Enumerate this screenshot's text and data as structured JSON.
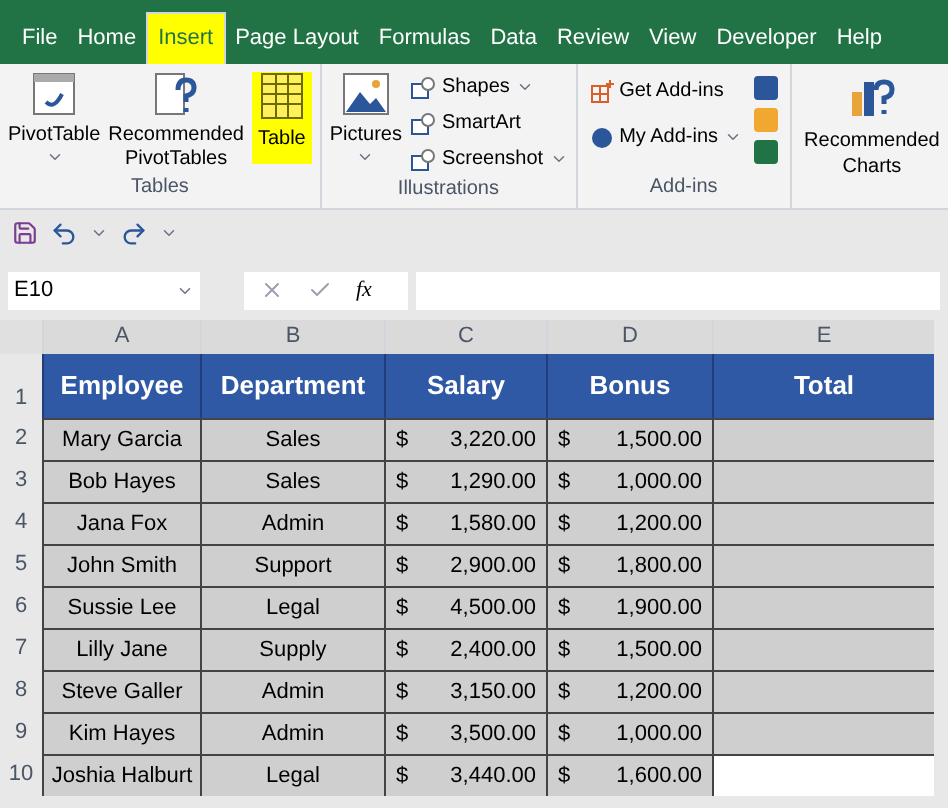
{
  "tabs": [
    {
      "label": "File",
      "selected": false
    },
    {
      "label": "Home",
      "selected": false
    },
    {
      "label": "Insert",
      "selected": true
    },
    {
      "label": "Page Layout",
      "selected": false
    },
    {
      "label": "Formulas",
      "selected": false
    },
    {
      "label": "Data",
      "selected": false
    },
    {
      "label": "Review",
      "selected": false
    },
    {
      "label": "View",
      "selected": false
    },
    {
      "label": "Developer",
      "selected": false
    },
    {
      "label": "Help",
      "selected": false
    }
  ],
  "ribbon": {
    "tables": {
      "label": "Tables",
      "pivot_table": "PivotTable",
      "recommended_pivot": [
        "Recommended",
        "PivotTables"
      ],
      "table": {
        "label": "Table",
        "highlighted": true
      }
    },
    "illustrations": {
      "label": "Illustrations",
      "pictures": "Pictures",
      "items": [
        "Shapes",
        "SmartArt",
        "Screenshot"
      ]
    },
    "addins": {
      "label": "Add-ins",
      "get": "Get Add-ins",
      "my": "My Add-ins"
    },
    "charts": [
      "Recommended",
      "Charts"
    ]
  },
  "formula_bar": {
    "name_box": "E10",
    "fx": "fx"
  },
  "columns": [
    "A",
    "B",
    "C",
    "D",
    "E"
  ],
  "headers": [
    "Employee",
    "Department",
    "Salary",
    "Bonus",
    "Total"
  ],
  "rows": [
    {
      "num": "2",
      "employee": "Mary Garcia",
      "department": "Sales",
      "salary": "3,220.00",
      "bonus": "1,500.00",
      "total_selected": false
    },
    {
      "num": "3",
      "employee": "Bob Hayes",
      "department": "Sales",
      "salary": "1,290.00",
      "bonus": "1,000.00",
      "total_selected": false
    },
    {
      "num": "4",
      "employee": "Jana Fox",
      "department": "Admin",
      "salary": "1,580.00",
      "bonus": "1,200.00",
      "total_selected": false
    },
    {
      "num": "5",
      "employee": "John Smith",
      "department": "Support",
      "salary": "2,900.00",
      "bonus": "1,800.00",
      "total_selected": false
    },
    {
      "num": "6",
      "employee": "Sussie Lee",
      "department": "Legal",
      "salary": "4,500.00",
      "bonus": "1,900.00",
      "total_selected": false
    },
    {
      "num": "7",
      "employee": "Lilly Jane",
      "department": "Supply",
      "salary": "2,400.00",
      "bonus": "1,500.00",
      "total_selected": false
    },
    {
      "num": "8",
      "employee": "Steve Galler",
      "department": "Admin",
      "salary": "3,150.00",
      "bonus": "1,200.00",
      "total_selected": false
    },
    {
      "num": "9",
      "employee": "Kim Hayes",
      "department": "Admin",
      "salary": "3,500.00",
      "bonus": "1,000.00",
      "total_selected": false
    },
    {
      "num": "10",
      "employee": "Joshia Halburt",
      "department": "Legal",
      "salary": "3,440.00",
      "bonus": "1,600.00",
      "total_selected": true
    }
  ],
  "header_row_num": "1",
  "currency": "$"
}
